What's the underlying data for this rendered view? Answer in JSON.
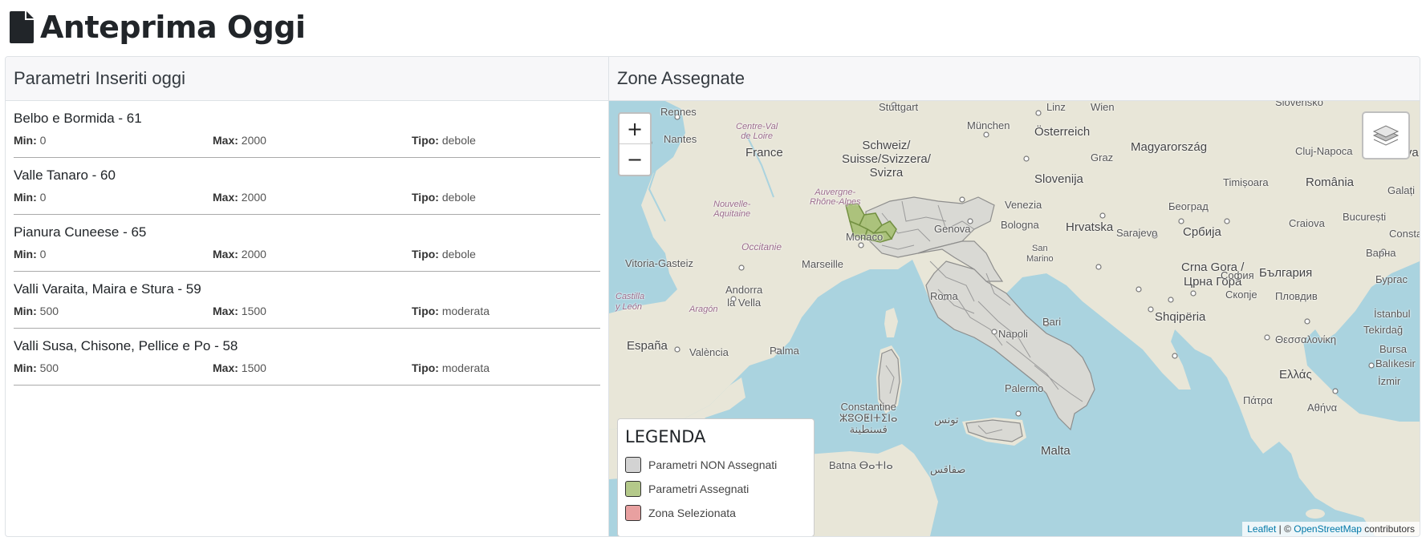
{
  "page": {
    "title": "Anteprima Oggi"
  },
  "left_panel": {
    "header": "Parametri Inseriti oggi",
    "labels": {
      "min": "Min:",
      "max": "Max:",
      "tipo": "Tipo:"
    },
    "items": [
      {
        "title": "Belbo e Bormida - 61",
        "min": "0",
        "max": "2000",
        "tipo": "debole"
      },
      {
        "title": "Valle Tanaro - 60",
        "min": "0",
        "max": "2000",
        "tipo": "debole"
      },
      {
        "title": "Pianura Cuneese - 65",
        "min": "0",
        "max": "2000",
        "tipo": "debole"
      },
      {
        "title": "Valli Varaita, Maira e Stura - 59",
        "min": "500",
        "max": "1500",
        "tipo": "moderata"
      },
      {
        "title": "Valli Susa, Chisone, Pellice e Po - 58",
        "min": "500",
        "max": "1500",
        "tipo": "moderata"
      }
    ]
  },
  "right_panel": {
    "header": "Zone Assegnate",
    "map": {
      "zoom_in": "+",
      "zoom_out": "−",
      "layers_icon": "layers-icon",
      "labels": {
        "rennes": "Rennes",
        "nantes": "Nantes",
        "centre": "Centre-Val\nde Loire",
        "france": "France",
        "stuttgart": "Stuttgart",
        "munchen": "München",
        "linz": "Linz",
        "wien": "Wien",
        "slovensko": "Slovensko",
        "osterreich": "Österreich",
        "schweiz": "Schweiz/\nSuisse/Svizzera/\nSvizra",
        "graz": "Graz",
        "magyar": "Magyarország",
        "cluj": "Cluj-Napoca",
        "moldova": "Moldova",
        "slovenija": "Slovenija",
        "timisoara": "Timișoara",
        "romania": "România",
        "galati": "Galați",
        "auvergne": "Auvergne-\nRhône-Alpes",
        "nouvelle": "Nouvelle-\nAquitaine",
        "venezia": "Venezia",
        "bologna": "Bologna",
        "hrvatska": "Hrvatska",
        "beograd": "Београд",
        "craiova": "Craiova",
        "bucuresti": "București",
        "constanta": "Consta",
        "genova": "Genova",
        "monaco": "Monaco",
        "sarajevo": "Sarajevo",
        "srbija": "Србија",
        "varna": "Варна",
        "occitanie": "Occitanie",
        "marseille": "Marseille",
        "sanmarino": "San\nMarino",
        "vitoria": "Vitoria-Gasteiz",
        "andorra": "Andorra\nla Vella",
        "crna": "Crna Gora /\nЦрна Гора",
        "sofia": "София",
        "bulgaria": "България",
        "burgas": "Бургас",
        "castilla": "Castilla\ny León",
        "aragon": "Aragón",
        "roma": "Roma",
        "skopje": "Скопје",
        "plovdiv": "Пловдив",
        "istanbul": "İstanbul",
        "shqiperia": "Shqipëria",
        "bari": "Bari",
        "napoli": "Napoli",
        "thessaloniki": "Θεσσαλονίκη",
        "tekirdag": "Tekirdağ",
        "bursa": "Bursa",
        "espana": "España",
        "valencia": "València",
        "palma": "Palma",
        "balikesir": "Balıkesir",
        "ellada": "Ελλάς",
        "izmir": "İzmir",
        "palermo": "Palermo",
        "patra": "Πάτρα",
        "athina": "Αθήνα",
        "constantine": "Constantine\nⵣⵓⵙⵟⵏⵜⵉⵏⴰ\nقسنطينة",
        "tunis": "تونس",
        "malta": "Malta",
        "batna": "Batna ⴱⴰⵜⵏⴰ",
        "safaqis": "صفاقس"
      },
      "legend": {
        "title": "LEGENDA",
        "items": [
          {
            "label": "Parametri NON Assegnati",
            "color": "#d3d3d3"
          },
          {
            "label": "Parametri Assegnati",
            "color": "#b4c98a"
          },
          {
            "label": "Zona Selezionata",
            "color": "#e8a0a0"
          }
        ]
      },
      "attribution": {
        "leaflet": "Leaflet",
        "sep": " | © ",
        "osm": "OpenStreetMap",
        "contributors": " contributors"
      }
    }
  },
  "colors": {
    "sea": "#aad3df",
    "land": "#e8e6d8",
    "assigned": "#b4c98a",
    "unassigned": "#d3d3d3"
  }
}
